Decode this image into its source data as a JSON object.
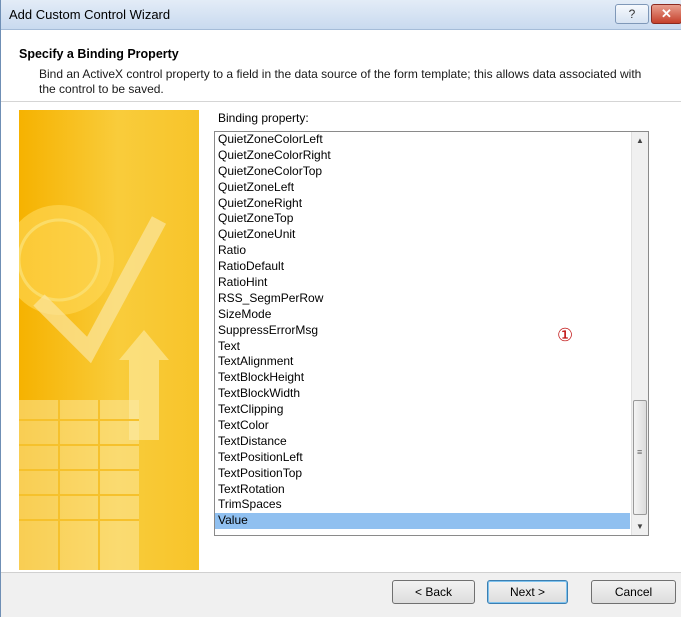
{
  "window": {
    "title": "Add Custom Control Wizard",
    "help_glyph": "?",
    "close_glyph": "✕"
  },
  "header": {
    "heading": "Specify a Binding Property",
    "description": "Bind an ActiveX control property to a field in the data source of the form template; this allows data associated with the control to be saved."
  },
  "field_label": "Binding property:",
  "list": {
    "items": [
      "QuietZoneColorLeft",
      "QuietZoneColorRight",
      "QuietZoneColorTop",
      "QuietZoneLeft",
      "QuietZoneRight",
      "QuietZoneTop",
      "QuietZoneUnit",
      "Ratio",
      "RatioDefault",
      "RatioHint",
      "RSS_SegmPerRow",
      "SizeMode",
      "SuppressErrorMsg",
      "Text",
      "TextAlignment",
      "TextBlockHeight",
      "TextBlockWidth",
      "TextClipping",
      "TextColor",
      "TextDistance",
      "TextPositionLeft",
      "TextPositionTop",
      "TextRotation",
      "TrimSpaces",
      "Value"
    ],
    "selected": "Value"
  },
  "annotation": "①",
  "buttons": {
    "back": "< Back",
    "next": "Next >",
    "cancel": "Cancel"
  },
  "colors": {
    "selection": "#90c0f0",
    "sidebar": "#f6b200",
    "annotation": "#c01010"
  }
}
